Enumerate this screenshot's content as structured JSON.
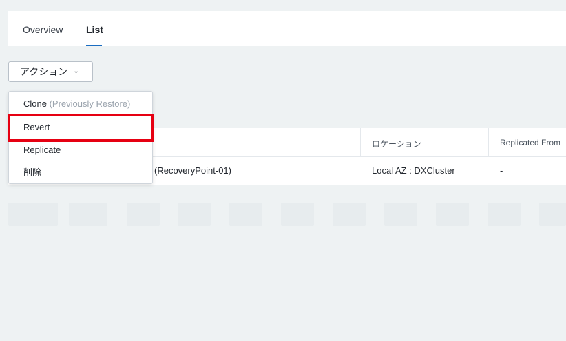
{
  "tabs": {
    "overview": "Overview",
    "list": "List"
  },
  "actions": {
    "label": "アクション",
    "chevron": "⌄"
  },
  "menu": {
    "clone_label": "Clone",
    "clone_note": "(Previously Restore)",
    "revert": "Revert",
    "replicate": "Replicate",
    "delete": "削除"
  },
  "table": {
    "columns": {
      "location": "ロケーション",
      "replicated_from": "Replicated From"
    },
    "row": {
      "name": "(RecoveryPoint-01)",
      "location": "Local AZ : DXCluster",
      "replicated_from": "-"
    }
  },
  "colors": {
    "accent": "#1b6dc1",
    "highlight": "#e60012",
    "background": "#eef2f3"
  }
}
